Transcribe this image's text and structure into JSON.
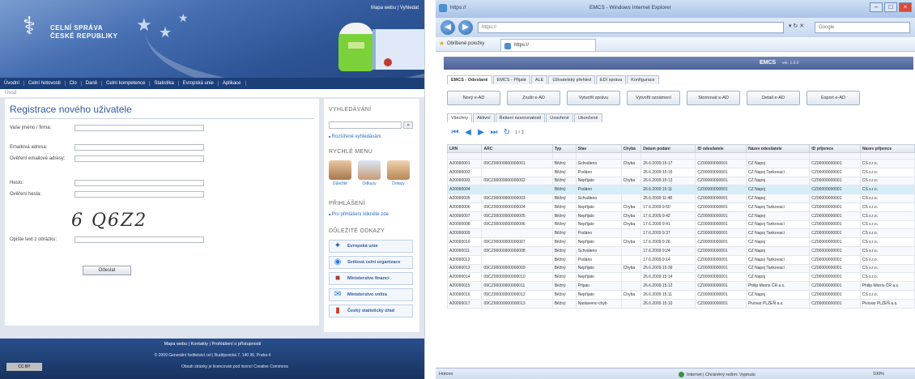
{
  "left": {
    "header": {
      "logo_line1": "CELNÍ SPRÁVA",
      "logo_line2": "ČESKÉ REPUBLIKY",
      "top_links": "Mapa webu | Vyhledat"
    },
    "nav": [
      "Úvodní",
      "Celní hotovosti",
      "Clo",
      "Daně",
      "Celní kompetence",
      "Statistika",
      "Evropská unie",
      "Aplikace"
    ],
    "breadcrumb": "Úvod",
    "form": {
      "title": "Registrace nového uživatele",
      "fields": [
        "Vaše jméno / firma:",
        "Emailová adresa:",
        "Ověření emailové adresy:",
        "Heslo:",
        "Ověření hesla:"
      ],
      "captcha": "6 Q6Z2",
      "captcha_label": "Opište text z obrázku:",
      "submit": "Odeslat"
    },
    "sidebar": {
      "search_heading": "VYHLEDÁVÁNÍ",
      "search_button": "»",
      "search_link": "Rozšířené vyhledávání",
      "quick_heading": "RYCHLÉ MENU",
      "quick_items": [
        "Důležité",
        "Odkazy",
        "Dotazy"
      ],
      "login_heading": "PŘIHLÁŠENÍ",
      "login_link": "Pro přihlášení klikněte zde",
      "links_heading": "DŮLEŽITÉ ODKAZY",
      "links": [
        "Evropská unie",
        "Světová celní organizace",
        "Ministerstvo financí",
        "Ministerstvo vnitra",
        "Český statistický úřad"
      ]
    },
    "footer": {
      "line1": "Mapa webu | Kontakty | Prohlášení o přístupnosti",
      "line2": "© 2009 Generální ředitelství cel | Budějovická 7, 140 96, Praha 4",
      "line3": "Obsah stránky je licencován pod licencí Creative Commons",
      "cc": "CC BY"
    }
  },
  "right": {
    "window_title": "EMCS - Windows Internet Explorer",
    "window_label": "https://",
    "address": "https://",
    "search_placeholder": "Google",
    "favorites": "Oblíbené položky",
    "tab_label": "https://",
    "app_title": "EMCS",
    "app_version": "ver. 1.0.0",
    "top_tabs": [
      "EMCS - Odeslané",
      "EMCS - Přijaté",
      "ALE",
      "Uživatelský přehled",
      "EDI správa",
      "Konfigurace"
    ],
    "action_buttons": [
      "Nový e-AD",
      "Zrušit e-AD",
      "Vytvořit zprávu",
      "Vytvořit oznámení",
      "Stornovat e-AD",
      "Detail e-AD",
      "Export e-AD"
    ],
    "sub_tabs": [
      "Všechny",
      "Aktivní",
      "Řešení nesrovnalostí",
      "Uzavřené",
      "Ukončené"
    ],
    "pager_text": "1 / 3",
    "grid": {
      "columns": [
        "LRN",
        "ARC",
        "Typ",
        "Stav",
        "Chyba",
        "Datum podání",
        "ID odesílatele",
        "Název odesílatele",
        "ID příjemce",
        "Název příjemce"
      ],
      "rows": [
        [
          "A20090001",
          "09CZ00000000000001",
          "Běžný",
          "Schváleno",
          "Chyba",
          "26.6.2009 15:17",
          "CZ00000000001",
          "CZ Napoj",
          "CZ00000000001",
          "CS s.r.o."
        ],
        [
          "A20090002",
          "",
          "Běžný",
          "Podáno",
          "",
          "26.6.2009 15:15",
          "CZ00000000001",
          "CZ Napoj Tankovací",
          "CZ00000000001",
          "CS s.r.o."
        ],
        [
          "A20090003",
          "09CZ00000000000002",
          "Běžný",
          "Nepřijato",
          "Chyba",
          "26.6.2009 15:13",
          "CZ00000000001",
          "CZ Napoj",
          "CZ00000000001",
          "CS s.r.o."
        ],
        [
          "A20090004",
          "",
          "Běžný",
          "Podáno",
          "",
          "26.6.2009 15:11",
          "CZ00000000001",
          "CZ Napoj",
          "CZ00000000001",
          "CS s.r.o."
        ],
        [
          "A20090005",
          "09CZ00000000000003",
          "Běžný",
          "Schváleno",
          "",
          "26.6.2009 11:48",
          "CZ00000000001",
          "CZ Napoj",
          "CZ00000000001",
          "CS s.r.o."
        ],
        [
          "A20090006",
          "09CZ00000000000004",
          "Běžný",
          "Nepřijato",
          "Chyba",
          "17.6.2009 9:50",
          "CZ00000000001",
          "CZ Napoj Tankovací",
          "CZ00000000001",
          "CS s.r.o."
        ],
        [
          "A20090007",
          "09CZ00000000000005",
          "Běžný",
          "Nepřijato",
          "Chyba",
          "17.6.2009 9:42",
          "CZ00000000001",
          "CZ Napoj",
          "CZ00000000001",
          "CS s.r.o."
        ],
        [
          "A20090008",
          "09CZ00000000000006",
          "Běžný",
          "Nepřijato",
          "Chyba",
          "17.6.2009 9:41",
          "CZ00000000001",
          "CZ Napoj Tankovací",
          "CZ00000000001",
          "CS s.r.o."
        ],
        [
          "A20090009",
          "",
          "Běžný",
          "Podáno",
          "",
          "17.6.2009 9:37",
          "CZ00000000001",
          "CZ Napoj Tankovací",
          "CZ00000000001",
          "CS s.r.o."
        ],
        [
          "A20090010",
          "09CZ00000000000007",
          "Běžný",
          "Nepřijato",
          "Chyba",
          "17.6.2009 9:26",
          "CZ00000000001",
          "CZ Napoj",
          "CZ00000000001",
          "CS s.r.o."
        ],
        [
          "A20090011",
          "09CZ00000000000008",
          "Běžný",
          "Schváleno",
          "",
          "17.6.2009 9:24",
          "CZ00000000001",
          "CZ Napoj",
          "CZ00000000001",
          "CS s.r.o."
        ],
        [
          "A20090012",
          "",
          "Běžný",
          "Podáno",
          "",
          "17.6.2009 9:14",
          "CZ00000000001",
          "CZ Napoj Tankovací",
          "CZ00000000001",
          "CS s.r.o."
        ],
        [
          "A20090013",
          "09CZ00000000000009",
          "Běžný",
          "Nepřijato",
          "Chyba",
          "26.6.2009 15:39",
          "CZ00000000001",
          "CZ Napoj Tankovací",
          "CZ00000000001",
          "CS s.r.o."
        ],
        [
          "A20090014",
          "09CZ00000000000010",
          "Běžný",
          "Nepřijato",
          "",
          "26.6.2009 15:14",
          "CZ00000000001",
          "CZ Napoj",
          "CZ00000000001",
          "CS s.r.o."
        ],
        [
          "A20090015",
          "09CZ00000000000011",
          "Běžný",
          "Přijato",
          "",
          "26.6.2009 15:12",
          "CZ00000000001",
          "Philip Morris ČR a.s.",
          "CZ00000000001",
          "Philip Morris ČR a.s."
        ],
        [
          "A20090016",
          "09CZ00000000000012",
          "Běžný",
          "Nepřijato",
          "Chyba",
          "26.6.2009 15:11",
          "CZ00000000001",
          "CZ Napoj",
          "CZ00000000001",
          "CS s.r.o."
        ],
        [
          "A20090017",
          "09CZ00000000000013",
          "Běžný",
          "Nastaveno chyb",
          "",
          "26.6.2009 15:10",
          "CZ00000000001",
          "Pivovar PLZEŇ a.s.",
          "CZ00000000001",
          "Pivovar PLZEŇ a.s."
        ]
      ]
    },
    "status": {
      "left": "Hotovo",
      "zone": "Internet | Chráněný režim: Vypnuto",
      "zoom": "100%"
    }
  }
}
